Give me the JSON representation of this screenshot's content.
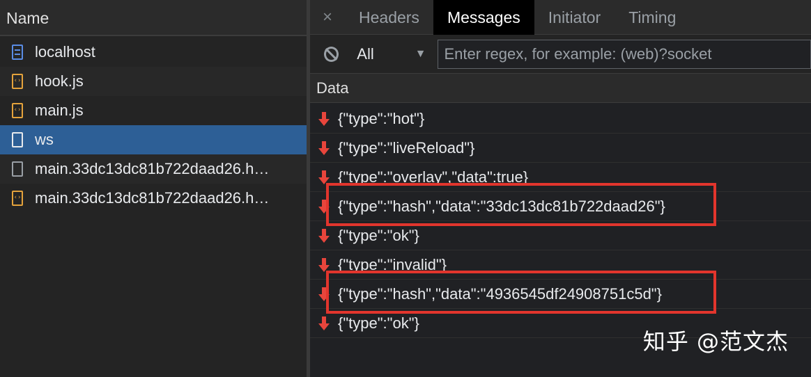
{
  "network": {
    "name_header": "Name",
    "requests": [
      {
        "name": "localhost",
        "icon": "document-icon"
      },
      {
        "name": "hook.js",
        "icon": "script-icon"
      },
      {
        "name": "main.js",
        "icon": "script-icon"
      },
      {
        "name": "ws",
        "icon": "websocket-icon",
        "selected": true
      },
      {
        "name": "main.33dc13dc81b722daad26.h…",
        "icon": "file-icon"
      },
      {
        "name": "main.33dc13dc81b722daad26.h…",
        "icon": "script-icon"
      }
    ]
  },
  "details": {
    "close_symbol": "×",
    "tabs": [
      "Headers",
      "Messages",
      "Initiator",
      "Timing"
    ],
    "active_tab": "Messages",
    "filter": {
      "selected_type": "All",
      "placeholder": "Enter regex, for example: (web)?socket",
      "value": ""
    },
    "data_header": "Data",
    "messages": [
      "{\"type\":\"hot\"}",
      "{\"type\":\"liveReload\"}",
      "{\"type\":\"overlay\",\"data\":true}",
      "{\"type\":\"hash\",\"data\":\"33dc13dc81b722daad26\"}",
      "{\"type\":\"ok\"}",
      "{\"type\":\"invalid\"}",
      "{\"type\":\"hash\",\"data\":\"4936545df24908751c5d\"}",
      "{\"type\":\"ok\"}"
    ]
  },
  "watermark": "知乎 @范文杰",
  "colors": {
    "selected_row": "#2d5f96",
    "received_arrow": "#e8453c",
    "highlight_box": "#e2352d"
  }
}
